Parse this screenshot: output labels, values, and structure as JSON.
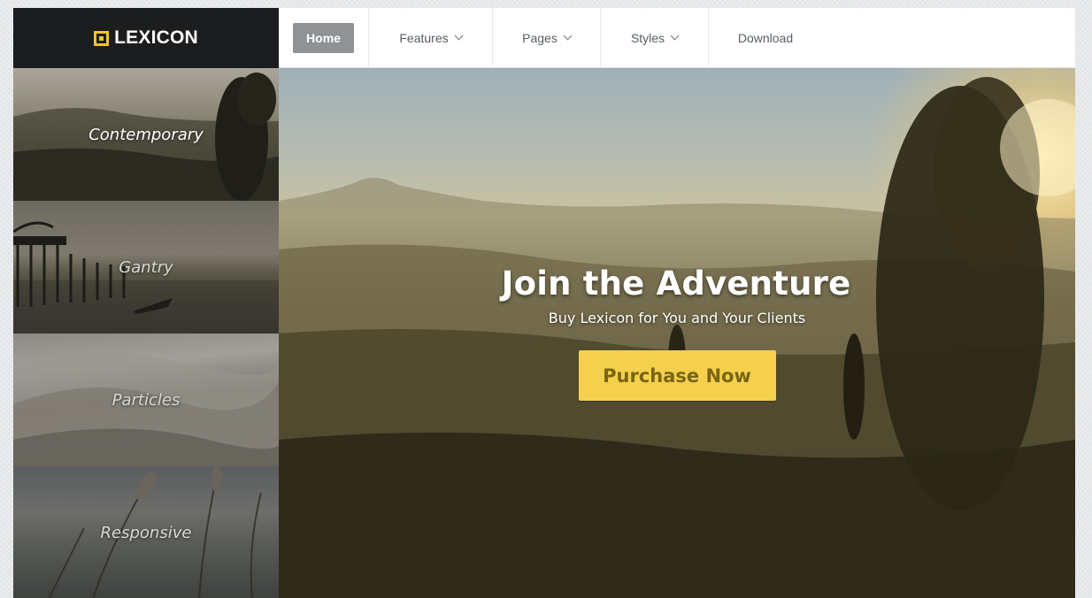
{
  "brand": {
    "name": "LEXICON",
    "accent": "#f2c230"
  },
  "nav": {
    "items": [
      {
        "label": "Home",
        "active": true
      },
      {
        "label": "Features",
        "dropdown": true
      },
      {
        "label": "Pages",
        "dropdown": true
      },
      {
        "label": "Styles",
        "dropdown": true
      },
      {
        "label": "Download",
        "dropdown": false
      }
    ],
    "icons": {
      "dropdown": "chevron-down-icon",
      "logo": "lexicon-logo-icon"
    }
  },
  "sidebar": {
    "tiles": [
      {
        "label": "Contemporary"
      },
      {
        "label": "Gantry"
      },
      {
        "label": "Particles"
      },
      {
        "label": "Responsive"
      }
    ]
  },
  "hero": {
    "title": "Join the Adventure",
    "subtitle": "Buy Lexicon for You and Your Clients",
    "cta_label": "Purchase Now",
    "cta_color": "#f4d04d",
    "cta_text_color": "#7a6512"
  }
}
